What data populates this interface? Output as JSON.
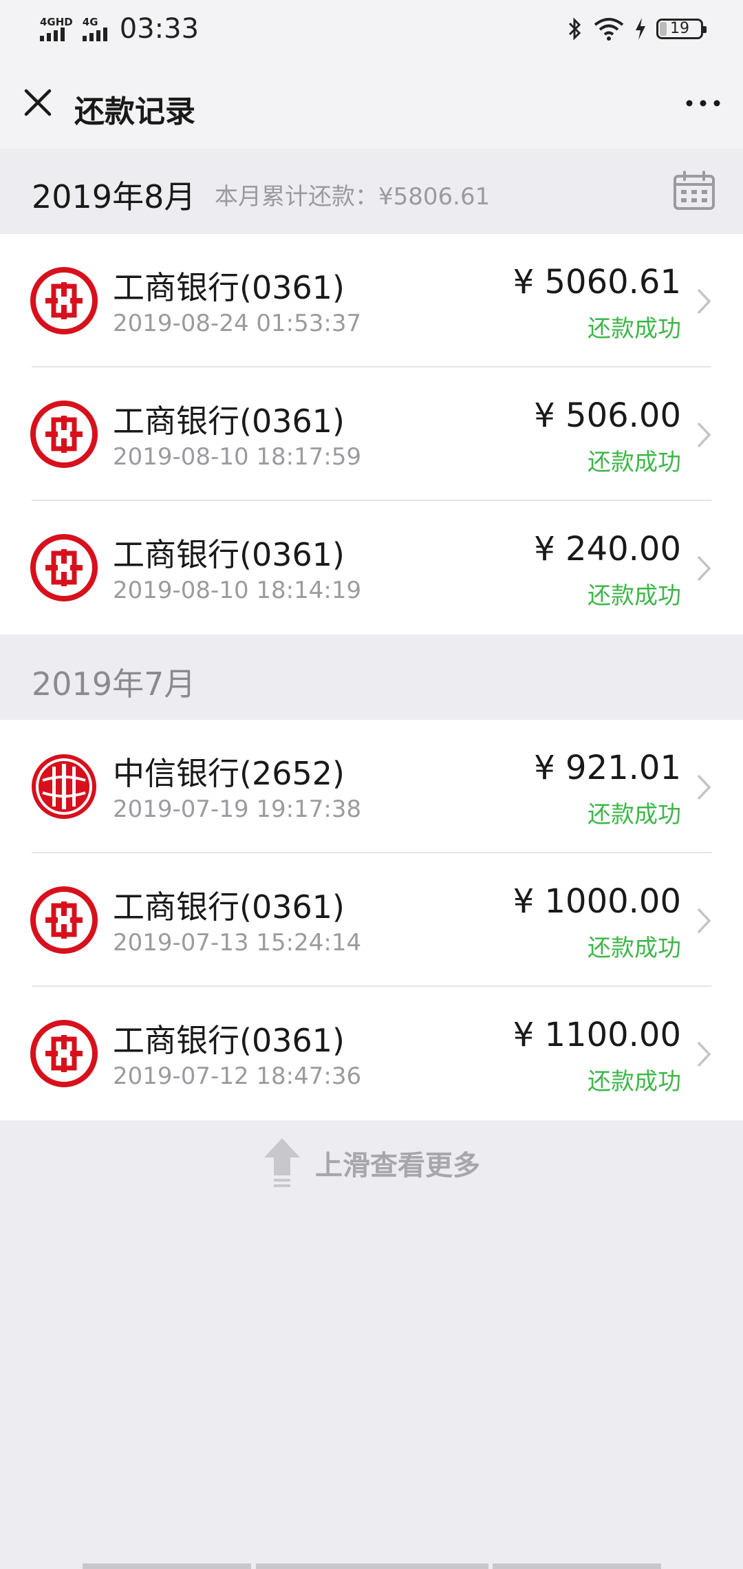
{
  "status_bar": {
    "network1": "4GHD",
    "network2": "4G",
    "time": "03:33",
    "battery": "19"
  },
  "nav": {
    "title": "还款记录",
    "close_icon": "close-icon",
    "more_icon": "more-icon"
  },
  "sections": [
    {
      "month": "2019年8月",
      "summary": "本月累计还款：¥5806.61",
      "records": [
        {
          "bank": "工商银行(0361)",
          "time": "2019-08-24 01:53:37",
          "amount": "¥ 5060.61",
          "status": "还款成功",
          "logo": "icbc-logo-icon"
        },
        {
          "bank": "工商银行(0361)",
          "time": "2019-08-10 18:17:59",
          "amount": "¥ 506.00",
          "status": "还款成功",
          "logo": "icbc-logo-icon"
        },
        {
          "bank": "工商银行(0361)",
          "time": "2019-08-10 18:14:19",
          "amount": "¥ 240.00",
          "status": "还款成功",
          "logo": "icbc-logo-icon"
        }
      ]
    },
    {
      "month": "2019年7月",
      "summary": "",
      "records": [
        {
          "bank": "中信银行(2652)",
          "time": "2019-07-19 19:17:38",
          "amount": "¥ 921.01",
          "status": "还款成功",
          "logo": "citic-logo-icon"
        },
        {
          "bank": "工商银行(0361)",
          "time": "2019-07-13 15:24:14",
          "amount": "¥ 1000.00",
          "status": "还款成功",
          "logo": "icbc-logo-icon"
        },
        {
          "bank": "工商银行(0361)",
          "time": "2019-07-12 18:47:36",
          "amount": "¥ 1100.00",
          "status": "还款成功",
          "logo": "icbc-logo-icon"
        }
      ]
    }
  ],
  "more_hint": "上滑查看更多",
  "colors": {
    "accent_green": "#3FB64A",
    "bank_red": "#D7101C",
    "background": "#EDEDF1"
  }
}
